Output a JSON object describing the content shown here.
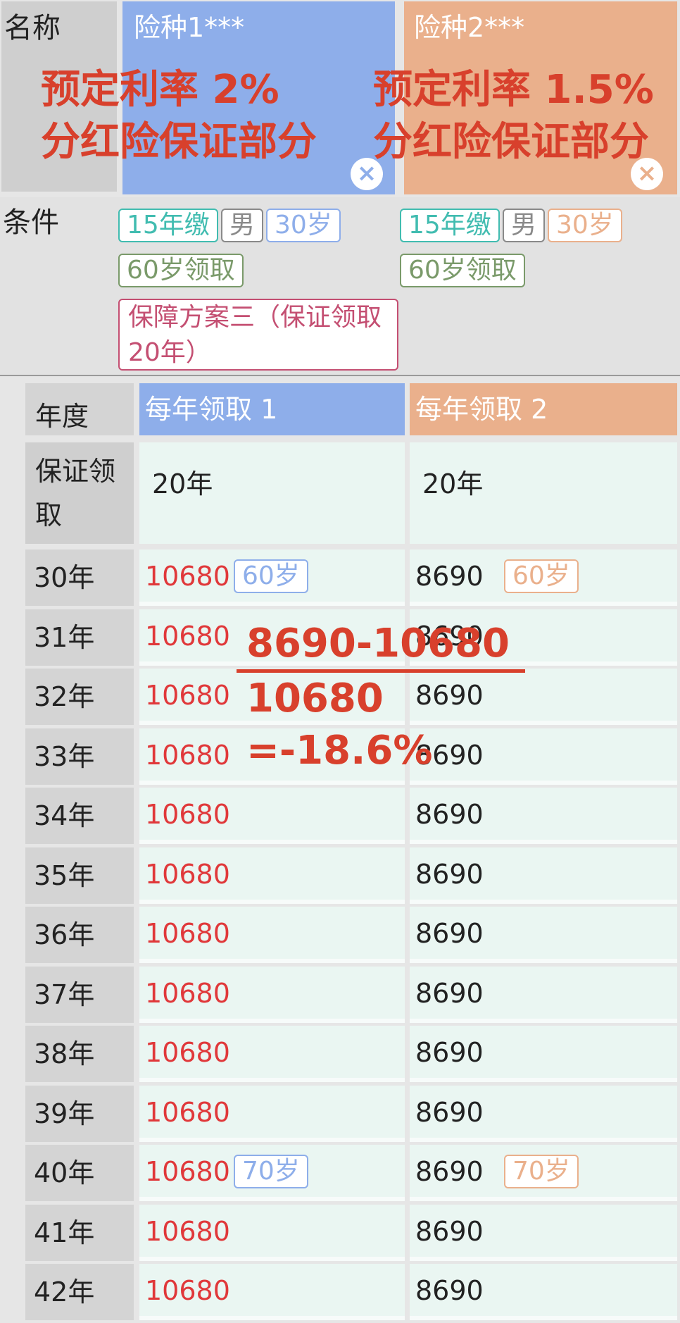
{
  "header": {
    "name_label": "名称",
    "products": [
      {
        "title": "险种1***",
        "annotation_line1": "预定利率 2%",
        "annotation_line2": "分红险保证部分",
        "close": "×"
      },
      {
        "title": "险种2***",
        "annotation_line1": "预定利率 1.5%",
        "annotation_line2": "分红险保证部分",
        "close": "×"
      }
    ]
  },
  "conditions": {
    "label": "条件",
    "product1": {
      "pay": "15年缴",
      "gender": "男",
      "age": "30岁",
      "receive": "60岁领取",
      "plan": "保障方案三（保证领取20年）"
    },
    "product2": {
      "pay": "15年缴",
      "gender": "男",
      "age": "30岁",
      "receive": "60岁领取"
    }
  },
  "table": {
    "year_header": "年度",
    "col1_header": "每年领取 1",
    "col2_header": "每年领取 2",
    "guarantee_label": "保证领取",
    "guarantee1": "20年",
    "guarantee2": "20年",
    "rows": [
      {
        "year": "30年",
        "v1": "10680",
        "v2": "8690",
        "tag1": "60岁",
        "tag2": "60岁"
      },
      {
        "year": "31年",
        "v1": "10680",
        "v2": "8690"
      },
      {
        "year": "32年",
        "v1": "10680",
        "v2": "8690"
      },
      {
        "year": "33年",
        "v1": "10680",
        "v2": "8690"
      },
      {
        "year": "34年",
        "v1": "10680",
        "v2": "8690"
      },
      {
        "year": "35年",
        "v1": "10680",
        "v2": "8690"
      },
      {
        "year": "36年",
        "v1": "10680",
        "v2": "8690"
      },
      {
        "year": "37年",
        "v1": "10680",
        "v2": "8690"
      },
      {
        "year": "38年",
        "v1": "10680",
        "v2": "8690"
      },
      {
        "year": "39年",
        "v1": "10680",
        "v2": "8690"
      },
      {
        "year": "40年",
        "v1": "10680",
        "v2": "8690",
        "tag1": "70岁",
        "tag2": "70岁"
      },
      {
        "year": "41年",
        "v1": "10680",
        "v2": "8690"
      },
      {
        "year": "42年",
        "v1": "10680",
        "v2": "8690"
      }
    ]
  },
  "overlay": {
    "numerator": "8690-10680",
    "denominator": "10680",
    "result": "=-18.6%"
  },
  "colors": {
    "product1": "#8eaeea",
    "product2": "#eab08c",
    "annotation": "#d8402c",
    "value1": "#e0383a"
  }
}
